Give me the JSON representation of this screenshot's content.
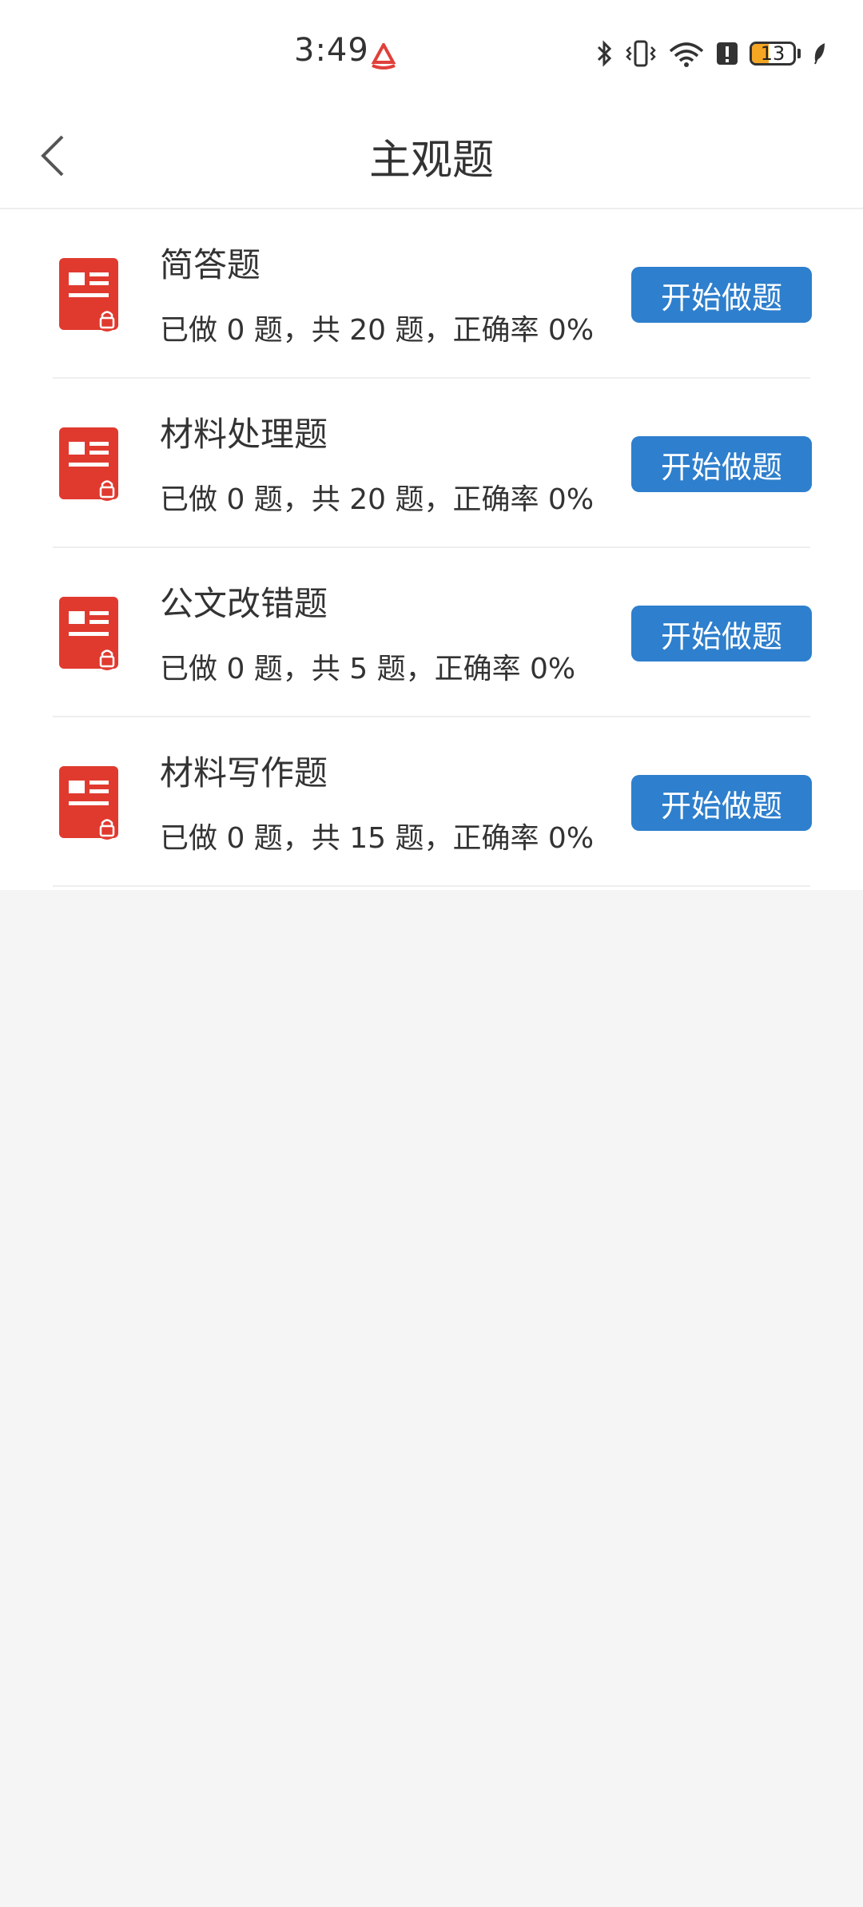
{
  "status_bar": {
    "time": "3:49",
    "battery_level": "13",
    "battery_fraction": 0.13
  },
  "header": {
    "title": "主观题"
  },
  "items": [
    {
      "title": "简答题",
      "stats": "已做 0 题，共 20 题，正确率 0%",
      "button": "开始做题"
    },
    {
      "title": "材料处理题",
      "stats": "已做 0 题，共 20 题，正确率 0%",
      "button": "开始做题"
    },
    {
      "title": "公文改错题",
      "stats": "已做 0 题，共 5 题，正确率 0%",
      "button": "开始做题"
    },
    {
      "title": "材料写作题",
      "stats": "已做 0 题，共 15 题，正确率 0%",
      "button": "开始做题"
    }
  ],
  "colors": {
    "accent": "#2e7fcd",
    "icon_red": "#e03a2f",
    "battery": "#f5a623"
  },
  "icons": {
    "back": "chevron-left-icon",
    "item": "locked-document-icon"
  }
}
